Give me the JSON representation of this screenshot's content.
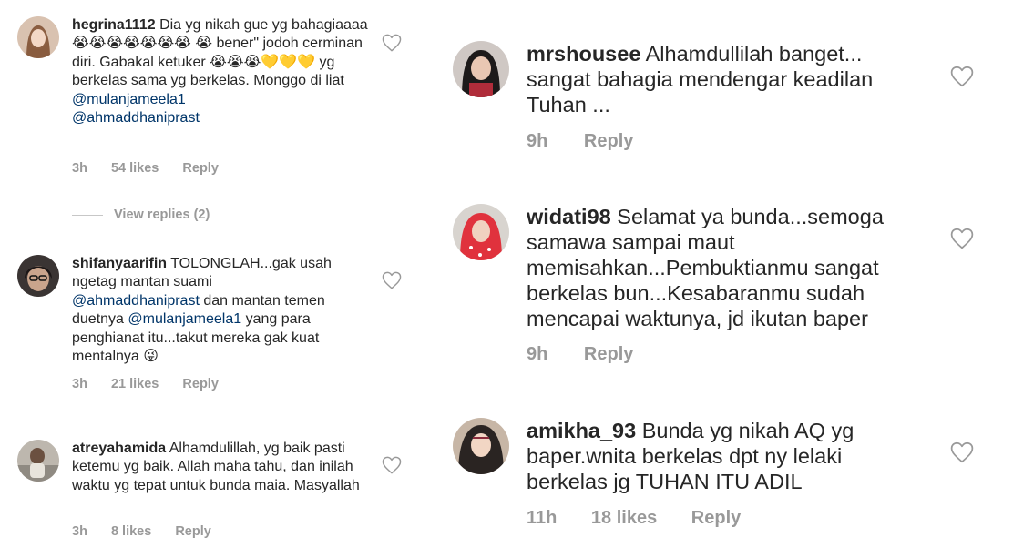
{
  "left": {
    "comments": [
      {
        "username": "hegrina1112",
        "text": " Dia yg nikah gue yg bahagiaaaa 😭😭😭😭😭😭😭 😭 bener\" jodoh cerminan diri. Gabakal ketuker 😭😭😭💛💛💛 yg berkelas sama yg berkelas. Monggo di liat ",
        "mention1": "@mulanjameela1",
        "mention2": "@ahmaddhaniprast",
        "time": "3h",
        "likes": "54 likes",
        "reply": "Reply"
      },
      {
        "username": "shifanyaarifin",
        "text_a": " TOLONGLAH...gak usah ngetag mantan suami ",
        "mention1": "@ahmaddhaniprast",
        "text_b": " dan mantan temen duetnya ",
        "mention2": "@mulanjameela1",
        "text_c": " yang para penghianat itu...takut mereka gak kuat mentalnya 😜",
        "time": "3h",
        "likes": "21 likes",
        "reply": "Reply"
      },
      {
        "username": "atreyahamida",
        "text": " Alhamdulillah,  yg baik pasti ketemu yg baik. Allah maha tahu, dan inilah waktu yg tepat untuk bunda maia. Masyallah",
        "time": "3h",
        "likes": "8 likes",
        "reply": "Reply"
      }
    ],
    "view_replies": "View replies (2)"
  },
  "right": {
    "comments": [
      {
        "username": "mrshousee",
        "text": " Alhamdullilah banget... sangat bahagia mendengar keadilan Tuhan ...",
        "time": "9h",
        "reply": "Reply"
      },
      {
        "username": "widati98",
        "text": " Selamat ya bunda...semoga samawa sampai maut memisahkan...Pembuktianmu sangat berkelas bun...Kesabaranmu sudah mencapai waktunya, jd ikutan baper",
        "time": "9h",
        "reply": "Reply"
      },
      {
        "username": "amikha_93",
        "text": " Bunda yg nikah AQ yg baper.wnita berkelas dpt ny lelaki berkelas jg TUHAN ITU ADIL",
        "time": "11h",
        "likes": "18 likes",
        "reply": "Reply"
      }
    ]
  },
  "colors": {
    "mention": "#003569",
    "meta": "#999999",
    "text": "#262626"
  }
}
